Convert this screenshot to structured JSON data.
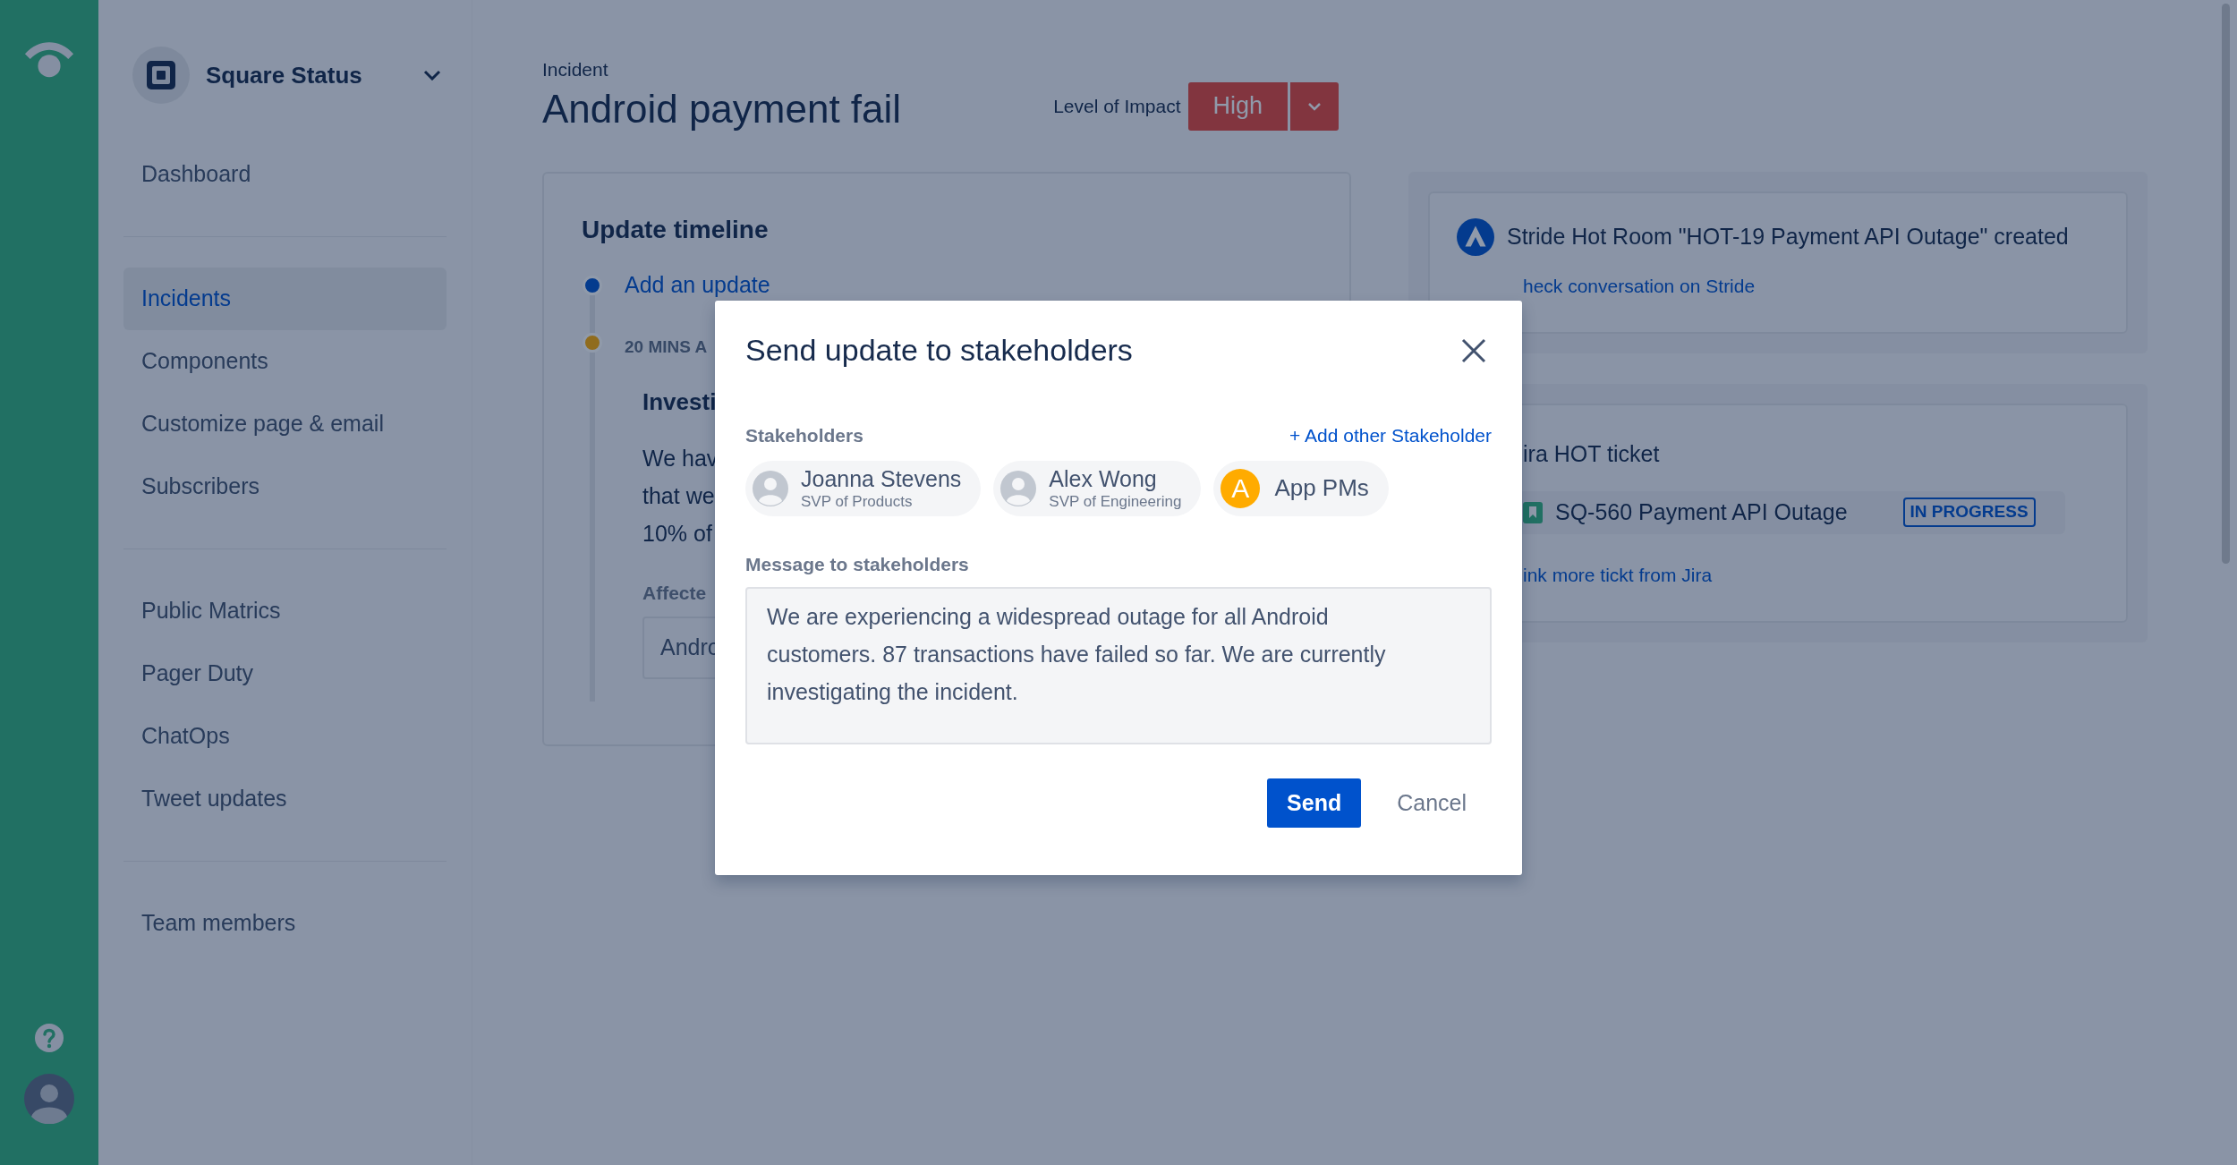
{
  "sidebar": {
    "workspace": "Square Status",
    "sections": [
      {
        "items": [
          {
            "label": "Dashboard",
            "selected": false
          }
        ]
      },
      {
        "items": [
          {
            "label": "Incidents",
            "selected": true
          },
          {
            "label": "Components",
            "selected": false
          },
          {
            "label": "Customize page & email",
            "selected": false
          },
          {
            "label": "Subscribers",
            "selected": false
          }
        ]
      },
      {
        "items": [
          {
            "label": "Public Matrics",
            "selected": false
          },
          {
            "label": "Pager Duty",
            "selected": false
          },
          {
            "label": "ChatOps",
            "selected": false
          },
          {
            "label": "Tweet updates",
            "selected": false
          }
        ]
      },
      {
        "items": [
          {
            "label": "Team members",
            "selected": false
          }
        ]
      }
    ]
  },
  "page": {
    "breadcrumb": "Incident",
    "title": "Android payment fail",
    "impact": {
      "label": "Level of Impact",
      "value": "High"
    }
  },
  "timeline": {
    "title": "Update timeline",
    "add_update": "Add an update",
    "entries": [
      {
        "time": "20 MINS A",
        "title": "Investi",
        "lines": [
          "We hav",
          "that we",
          "10% of"
        ],
        "affected_label": "Affecte",
        "affected_value": "Andro"
      }
    ]
  },
  "integrations": {
    "stride": {
      "title": "Stride Hot Room \"HOT-19 Payment API Outage\" created",
      "link": "heck conversation on Stride"
    },
    "jira": {
      "title": "ira HOT ticket",
      "ticket": "SQ-560 Payment API Outage",
      "status": "IN PROGRESS",
      "link": "ink more tickt from Jira"
    }
  },
  "dialog": {
    "title": "Send update to stakeholders",
    "stakeholders_label": "Stakeholders",
    "add_link": "+ Add other Stakeholder",
    "stakeholders": [
      {
        "kind": "person",
        "name": "Joanna Stevens",
        "role": "SVP of Products"
      },
      {
        "kind": "person",
        "name": "Alex Wong",
        "role": "SVP of Engineering"
      },
      {
        "kind": "group",
        "initial": "A",
        "name": "App PMs"
      }
    ],
    "message_label": "Message to stakeholders",
    "message": "We are experiencing a widespread outage for all Android customers. 87 transactions have failed so far. We are currently investigating the incident.",
    "send": "Send",
    "cancel": "Cancel"
  }
}
